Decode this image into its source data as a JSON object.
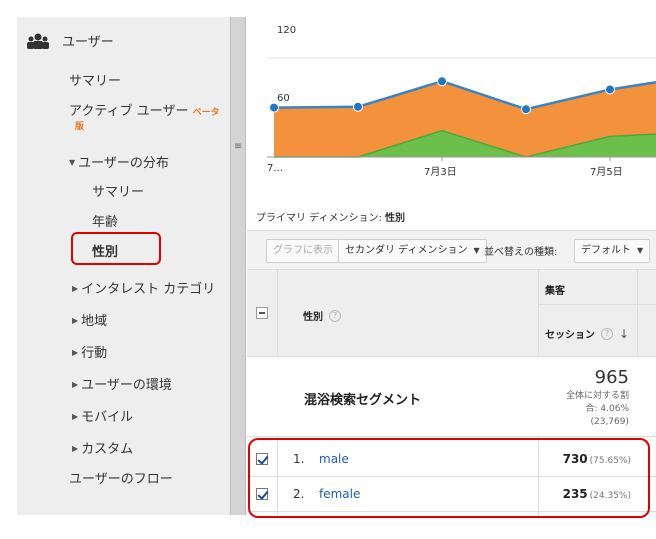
{
  "sidebar": {
    "header": "ユーザー",
    "items": {
      "summary": "サマリー",
      "active_users": "アクティブ ユーザー",
      "active_users_beta_a": "ベータ",
      "active_users_beta_b": "版",
      "distribution": "ユーザーの分布",
      "dist_summary": "サマリー",
      "dist_age": "年齢",
      "dist_gender": "性別",
      "interest": "インタレスト カテゴリ",
      "geo": "地域",
      "behavior": "行動",
      "environment": "ユーザーの環境",
      "mobile": "モバイル",
      "custom": "カスタム",
      "flow": "ユーザーのフロー"
    }
  },
  "chart_data": {
    "type": "area",
    "y_tick_labels": [
      "120",
      "60"
    ],
    "x_tick_labels": [
      "7...",
      "7月3日",
      "7月5日"
    ],
    "series": [
      {
        "values": [
          60,
          61,
          92,
          58,
          82,
          98
        ]
      },
      {
        "values": [
          0,
          0,
          32,
          0,
          25,
          30
        ]
      }
    ],
    "ylim": [
      0,
      170
    ],
    "colors": {
      "orange": "#f3913c",
      "green": "#6cbf4a",
      "line": "#3a83c4",
      "dot": "#2176c6"
    }
  },
  "primary_dimension": {
    "label": "プライマリ ディメンション:",
    "value": "性別"
  },
  "toolbar": {
    "graph_button": "グラフに表示",
    "secondary_dimension": "セカンダリ ディメンション",
    "sort_label": "並べ替えの種類:",
    "sort_value": "デフォルト"
  },
  "table": {
    "header_gender": "性別",
    "header_acquisition": "集客",
    "header_sessions": "セッション",
    "segment_name": "混浴検索セグメント",
    "segment_total": "965",
    "segment_sub1": "全体に対する割",
    "segment_sub2": "合: 4.06%",
    "segment_sub3": "(23,769)",
    "rows": [
      {
        "num": "1.",
        "name": "male",
        "value": "730",
        "pct": "(75.65%)"
      },
      {
        "num": "2.",
        "name": "female",
        "value": "235",
        "pct": "(24.35%)"
      }
    ]
  },
  "icons": {
    "help": "?",
    "sort_arrow": "↓",
    "caret": "▼",
    "triangle_down": "▼",
    "triangle_right": "▶"
  }
}
